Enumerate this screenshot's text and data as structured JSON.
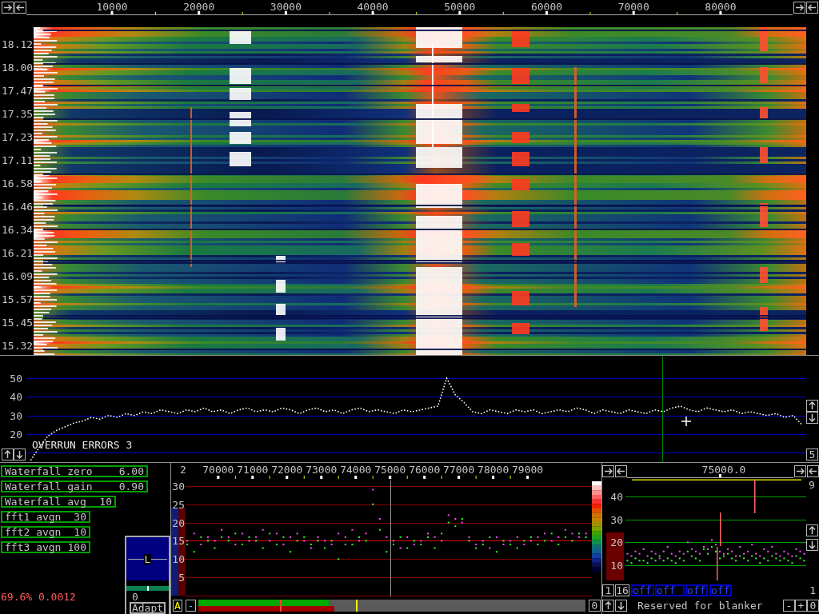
{
  "frequency_axis": {
    "labels": [
      "10000",
      "20000",
      "30000",
      "40000",
      "50000",
      "60000",
      "70000",
      "80000"
    ]
  },
  "waterfall": {
    "time_labels": [
      "18.12",
      "18.00",
      "17.47",
      "17.35",
      "17.23",
      "17.11",
      "16.58",
      "16.46",
      "16.34",
      "16.21",
      "16.09",
      "15.57",
      "15.45",
      "15.32"
    ]
  },
  "spectrum": {
    "chart_data": {
      "type": "line",
      "categories": [
        null,
        null,
        null,
        null,
        null,
        null,
        null,
        null,
        null,
        null,
        null,
        null,
        null,
        null,
        null,
        null,
        null,
        null,
        null,
        null,
        null,
        null,
        null,
        null,
        null,
        null,
        null,
        null,
        null,
        null,
        null,
        null,
        null,
        null,
        null,
        null,
        null,
        null,
        null,
        null,
        null,
        null,
        null,
        null,
        null,
        null,
        null,
        null,
        null,
        null,
        null,
        null,
        null,
        null,
        null,
        null,
        null,
        null,
        null,
        null,
        null,
        null,
        null,
        null,
        null,
        null,
        null,
        null,
        null,
        null,
        null,
        null,
        null,
        null,
        null,
        null,
        null,
        null,
        null,
        null,
        null,
        null,
        null,
        null,
        null,
        null,
        null,
        null,
        null,
        null
      ],
      "ylim": [
        5,
        50
      ],
      "yticks": [
        20,
        30,
        40,
        50
      ],
      "series": [
        {
          "color": "#ffffff",
          "line_style": "dotted",
          "values": [
            6,
            13,
            19,
            22,
            24,
            26,
            27,
            29,
            28,
            30,
            29,
            31,
            30,
            32,
            31,
            33,
            32,
            31,
            33,
            32,
            34,
            32,
            33,
            31,
            33,
            34,
            32,
            33,
            32,
            34,
            33,
            31,
            33,
            34,
            32,
            33,
            31,
            33,
            34,
            32,
            33,
            32,
            31,
            33,
            32,
            33,
            34,
            35,
            50,
            41,
            37,
            32,
            31,
            33,
            32,
            31,
            33,
            32,
            33,
            31,
            32,
            33,
            32,
            34,
            33,
            31,
            33,
            32,
            31,
            33,
            32,
            31,
            33,
            32,
            34,
            35,
            33,
            32,
            34,
            33,
            32,
            33,
            31,
            32,
            31,
            30,
            31,
            29,
            30,
            25
          ]
        }
      ],
      "ref_lines": [
        {
          "axis": "y",
          "value": 10
        },
        {
          "axis": "y",
          "value": 20
        },
        {
          "axis": "y",
          "value": 30
        },
        {
          "axis": "y",
          "value": 40
        },
        {
          "axis": "y",
          "value": 50
        }
      ]
    },
    "message": "OVERRUN ERRORS 3",
    "corner_button": "5"
  },
  "parameters": [
    {
      "label": "Waterfall zero",
      "value": "6.00"
    },
    {
      "label": "Waterfall gain",
      "value": "0.90"
    },
    {
      "label": "Waterfall avg",
      "value": "10"
    },
    {
      "label": "fft1 avgn",
      "value": "30"
    },
    {
      "label": "fft2 avgn",
      "value": "10"
    },
    {
      "label": "fft3 avgn",
      "value": "100"
    }
  ],
  "status_text": "69.6% 0.0012",
  "channel_panel": {
    "label": "L",
    "slider": {
      "level": 0.5
    },
    "reading": "0",
    "button": "Adapt"
  },
  "middle_panel": {
    "number": "2",
    "chart_data": {
      "type": "scatter",
      "x": [
        69100,
        69300,
        69500,
        69700,
        69900,
        70100,
        70300,
        70500,
        70700,
        70900,
        71100,
        71300,
        71500,
        71700,
        71900,
        72100,
        72300,
        72500,
        72700,
        72900,
        73100,
        73300,
        73500,
        73700,
        73900,
        74100,
        74300,
        74500,
        74700,
        74900,
        75100,
        75300,
        75500,
        75700,
        75900,
        76100,
        76300,
        76500,
        76700,
        76900,
        77100,
        77300,
        77500,
        77700,
        77900,
        78100,
        78300,
        78500,
        78700,
        78900,
        79100,
        79300,
        79500,
        79700,
        79900,
        80100,
        80300,
        80500,
        80700
      ],
      "xlim": [
        69050,
        80870
      ],
      "ylim": [
        0,
        30
      ],
      "xticks": [
        70000,
        71000,
        72000,
        73000,
        74000,
        75000,
        76000,
        77000,
        78000,
        79000
      ],
      "yticks": [
        5,
        10,
        15,
        20,
        25,
        30
      ],
      "series": [
        {
          "color": "#ff50ff",
          "values": [
            15,
            17,
            14,
            16,
            15,
            18,
            16,
            14,
            17,
            15,
            16,
            18,
            15,
            17,
            14,
            16,
            17,
            15,
            13,
            16,
            15,
            14,
            17,
            16,
            18,
            15,
            17,
            29,
            21,
            16,
            15,
            13,
            16,
            14,
            15,
            17,
            16,
            15,
            22,
            21,
            20,
            16,
            14,
            15,
            13,
            16,
            14,
            15,
            16,
            14,
            15,
            16,
            17,
            15,
            16,
            18,
            17,
            16,
            17
          ]
        },
        {
          "color": "#30ff30",
          "values": [
            14,
            12,
            16,
            15,
            13,
            16,
            15,
            17,
            14,
            16,
            15,
            13,
            17,
            14,
            16,
            12,
            15,
            16,
            14,
            15,
            13,
            15,
            10,
            14,
            14,
            16,
            15,
            25,
            18,
            12,
            14,
            16,
            13,
            15,
            14,
            16,
            13,
            17,
            20,
            19,
            21,
            15,
            13,
            14,
            16,
            12,
            15,
            14,
            13,
            15,
            16,
            14,
            15,
            17,
            14,
            16,
            15,
            17,
            16
          ]
        }
      ],
      "ref_lines": [
        {
          "axis": "y",
          "value": 0,
          "color": "#8a0000"
        },
        {
          "axis": "y",
          "value": 5,
          "color": "#8a0000"
        },
        {
          "axis": "y",
          "value": 10,
          "color": "#8a0000"
        },
        {
          "axis": "y",
          "value": 15,
          "color": "#e00000"
        },
        {
          "axis": "y",
          "value": 20,
          "color": "#8a0000"
        },
        {
          "axis": "y",
          "value": 25,
          "color": "#8a0000"
        },
        {
          "axis": "y",
          "value": 30,
          "color": "#8a0000"
        },
        {
          "axis": "x",
          "value": 75000,
          "color": "#909090"
        }
      ]
    },
    "left_buttons": [
      {
        "label": "A",
        "color": "#ffff00"
      },
      {
        "label": "-",
        "color": "#00e0e0"
      }
    ],
    "meters": [
      {
        "color": "#00a800",
        "level": 0.337
      },
      {
        "color": "#a00000",
        "level": 0.352
      }
    ],
    "markers": [
      {
        "color": "#ff4040",
        "level": 0.213
      },
      {
        "color": "#ffff00",
        "level": 0.41
      }
    ],
    "right_button": "0"
  },
  "right_panel": {
    "center_frequency": "75000.0",
    "top_number": "9",
    "chart_data": {
      "type": "scatter",
      "categories": [
        null,
        null,
        null,
        null,
        null,
        null,
        null,
        null,
        null,
        null,
        null,
        null,
        null,
        null,
        null,
        null,
        null,
        null,
        null,
        null,
        null,
        null,
        null,
        null,
        null,
        null,
        null,
        null,
        null,
        null,
        null,
        null,
        null,
        null,
        null,
        null,
        null,
        null,
        null,
        null,
        null,
        null,
        null,
        null,
        null
      ],
      "ylim": [
        10,
        40
      ],
      "yticks": [
        10,
        20,
        30,
        40
      ],
      "series": [
        {
          "color": "#ff50ff",
          "values": [
            15,
            14,
            16,
            15,
            17,
            14,
            16,
            15,
            13,
            16,
            18,
            15,
            14,
            16,
            15,
            20,
            17,
            16,
            15,
            18,
            17,
            21,
            19,
            16,
            15,
            17,
            16,
            14,
            18,
            15,
            16,
            19,
            15,
            14,
            17,
            16,
            18,
            15,
            14,
            16,
            15,
            14,
            17,
            16,
            15
          ]
        },
        {
          "color": "#30ff30",
          "values": [
            12,
            11,
            13,
            12,
            12,
            11,
            13,
            12,
            14,
            12,
            13,
            12,
            11,
            13,
            12,
            16,
            14,
            13,
            12,
            17,
            15,
            18,
            16,
            13,
            14,
            15,
            13,
            12,
            14,
            13,
            12,
            14,
            13,
            11,
            13,
            12,
            14,
            13,
            12,
            13,
            12,
            11,
            14,
            13,
            12
          ]
        }
      ],
      "ref_lines": [
        {
          "axis": "y",
          "value": 10
        },
        {
          "axis": "y",
          "value": 20
        },
        {
          "axis": "y",
          "value": 30
        },
        {
          "axis": "y",
          "value": 40
        }
      ]
    },
    "number_buttons": [
      "1",
      "16"
    ],
    "toggles": [
      "off",
      "off",
      "off",
      "off"
    ],
    "side_number": "1",
    "caption": "Reserved for blanker",
    "buttons": [
      "-",
      "+",
      "0"
    ]
  }
}
